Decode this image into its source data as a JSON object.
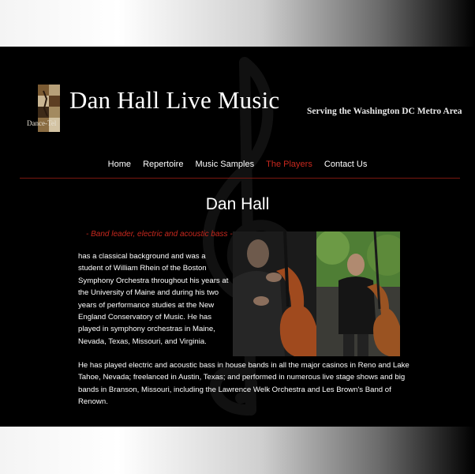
{
  "site": {
    "logo_text": "Dance-Tel",
    "title": "Dan Hall Live Music",
    "tagline": "Serving the Washington DC Metro Area"
  },
  "nav": {
    "items": [
      {
        "label": "Home",
        "active": false
      },
      {
        "label": "Repertoire",
        "active": false
      },
      {
        "label": "Music Samples",
        "active": false
      },
      {
        "label": "The Players",
        "active": true
      },
      {
        "label": "Contact Us",
        "active": false
      }
    ]
  },
  "main": {
    "title": "Dan Hall",
    "role": "- Band leader, electric and acoustic bass -",
    "paragraph1": "has a classical background and was a student of William Rhein of the Boston Symphony Orchestra throughout his years at the University of Maine and during his two years of performance studies at the New England Conservatory of Music. He has played in symphony orchestras in Maine, Nevada, Texas, Missouri, and Virginia.",
    "paragraph2": "He has played electric and acoustic bass in house bands in all the major casinos in Reno and Lake Tahoe, Nevada; freelanced in Austin, Texas; and performed in numerous live stage shows and big bands in Branson, Missouri, including the Lawrence Welk Orchestra and Les Brown's Band of Renown."
  },
  "colors": {
    "accent": "#c8281e",
    "background": "#000000",
    "text": "#ffffff"
  }
}
